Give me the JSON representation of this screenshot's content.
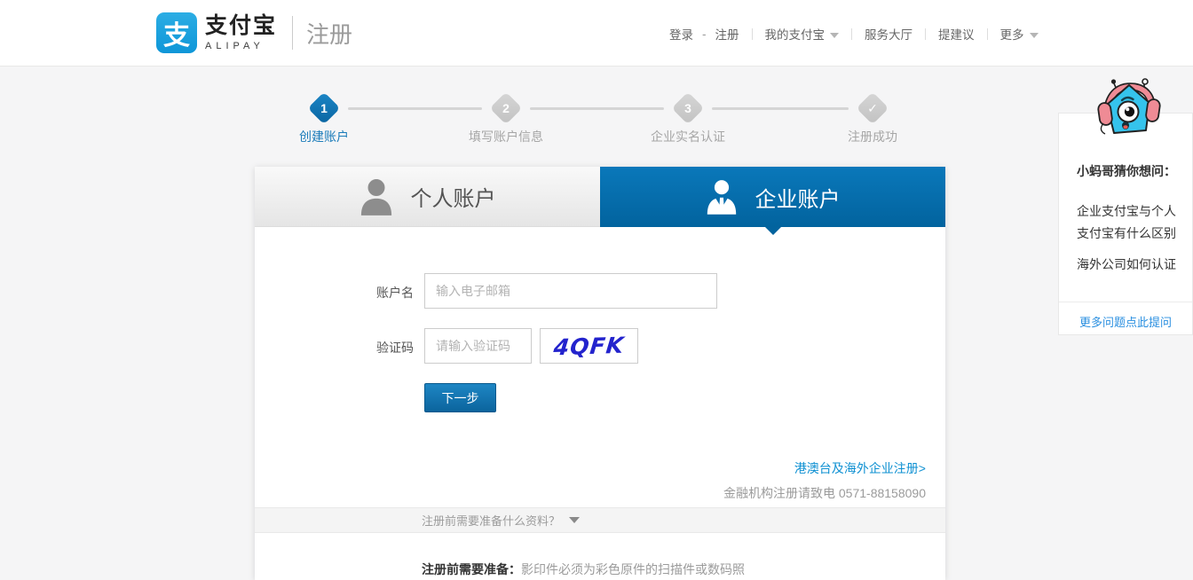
{
  "header": {
    "logo": {
      "icon_char": "支",
      "brand_cn": "支付宝",
      "brand_en": "ALIPAY",
      "page_title": "注册"
    },
    "nav": {
      "login": "登录",
      "dash": "-",
      "register": "注册",
      "my_alipay": "我的支付宝",
      "service_hall": "服务大厅",
      "suggestion": "提建议",
      "more": "更多"
    }
  },
  "steps": {
    "items": [
      {
        "num": "1",
        "label": "创建账户"
      },
      {
        "num": "2",
        "label": "填写账户信息"
      },
      {
        "num": "3",
        "label": "企业实名认证"
      },
      {
        "num": "✓",
        "label": "注册成功"
      }
    ]
  },
  "tabs": {
    "personal": "个人账户",
    "enterprise": "企业账户"
  },
  "form": {
    "account_label": "账户名",
    "account_placeholder": "输入电子邮箱",
    "captcha_label": "验证码",
    "captcha_placeholder": "请输入验证码",
    "captcha_text": "4QFK",
    "next_button": "下一步",
    "overseas_link": "港澳台及海外企业注册>",
    "finance_note": "金融机构注册请致电 0571-88158090",
    "accordion_title": "注册前需要准备什么资料？",
    "prep_bold": "注册前需要准备：",
    "prep_text": "影印件必须为彩色原件的扫描件或数码照"
  },
  "helper": {
    "title": "小蚂哥猜你想问：",
    "questions": [
      "企业支付宝与个人支付宝有什么区别",
      "海外公司如何认证"
    ],
    "more_link": "更多问题点此提问"
  },
  "colors": {
    "brand_blue": "#1296db",
    "tab_blue": "#0a78ba",
    "button_blue": "#0b649d",
    "link_blue": "#0e90d2",
    "captcha_blue": "#2323cd",
    "active_step_blue": "#1b7cba"
  }
}
